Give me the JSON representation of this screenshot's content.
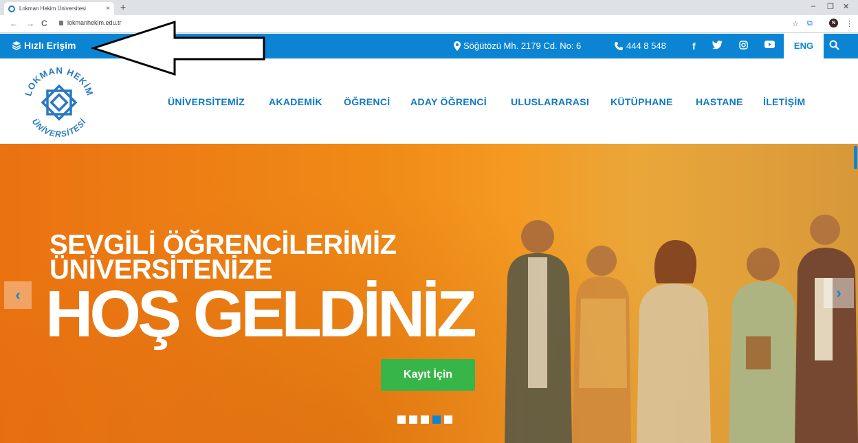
{
  "browser": {
    "tab_title": "Lokman Hekim Üniversitesi",
    "tab_close": "×",
    "new_tab": "+",
    "url": "lokmanhekim.edu.tr",
    "profile_initial": "N",
    "controls": {
      "minimize": "–",
      "restore": "❐",
      "close": "✕"
    },
    "nav": {
      "back": "←",
      "forward": "→",
      "reload": "C"
    },
    "icons": {
      "star": "☆",
      "ext": "⧉",
      "menu": "⋮"
    }
  },
  "topbar": {
    "quick_access": "Hızlı Erişim",
    "address": "Söğütözü Mh. 2179 Cd. No: 6",
    "phone": "444 8 548",
    "lang": "ENG",
    "social": [
      "f",
      "t",
      "ig",
      "yt"
    ],
    "accent_color": "#0b85d3"
  },
  "logo": {
    "top_text": "LOKMAN HEKİM",
    "bottom_text": "ÜNİVERSİTESİ"
  },
  "nav": {
    "items": [
      {
        "label": "ÜNİVERSİTEMİZ"
      },
      {
        "label": "AKADEMİK"
      },
      {
        "label": "ÖĞRENCİ"
      },
      {
        "label": "ADAY ÖĞRENCİ"
      },
      {
        "label": "ULUSLARARASI"
      },
      {
        "label": "KÜTÜPHANE"
      },
      {
        "label": "HASTANE"
      },
      {
        "label": "İLETİŞİM"
      }
    ]
  },
  "hero": {
    "line1": "SEVGİLİ ÖĞRENCİLERİMİZ",
    "line2": "ÜNİVERSİTENİZE",
    "headline": "HOŞ GELDİNİZ",
    "cta": "Kayıt İçin",
    "prev": "‹",
    "next": "›",
    "slides": 5,
    "active_slide": 4,
    "cta_color": "#38b549"
  }
}
